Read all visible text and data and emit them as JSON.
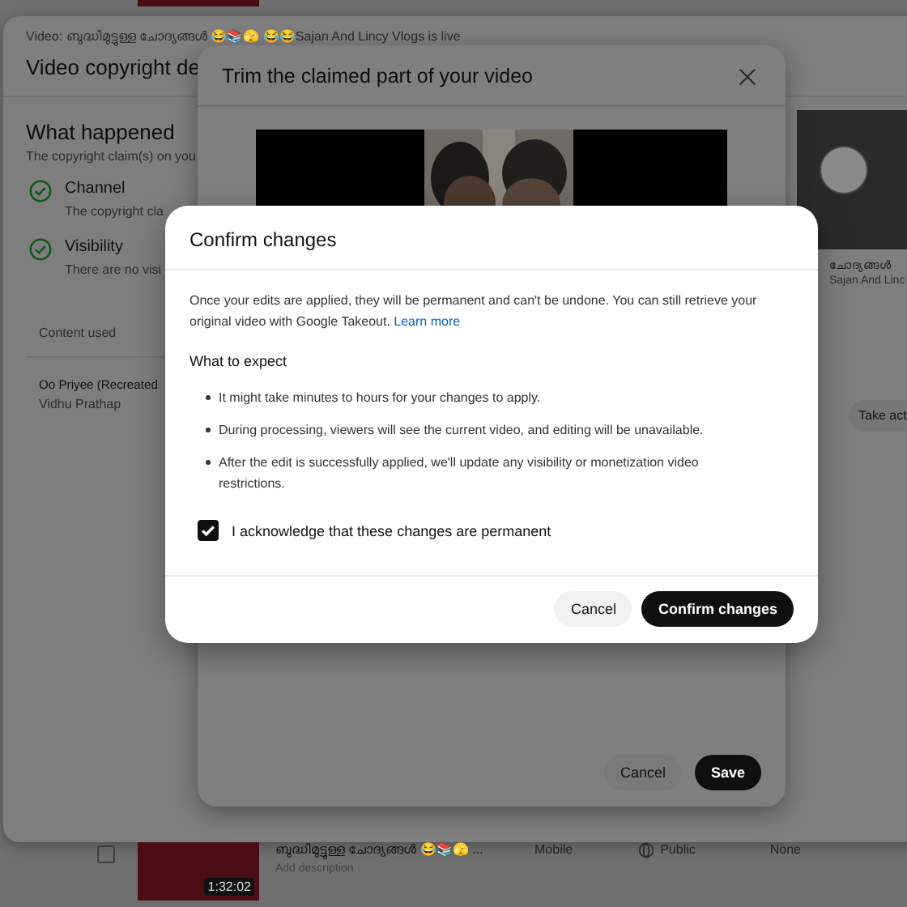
{
  "copyright_panel": {
    "video_line": "Video: ബുദ്ധിമുട്ടുള്ള ചോദ്യങ്ങൾ 😂📚🫣 😂😂Sajan And Lincy Vlogs is live",
    "title": "Video copyright de",
    "section_title": "What happened",
    "section_subtitle": "The copyright claim(s) on you",
    "checks": [
      {
        "label": "Channel",
        "detail": "The copyright cla"
      },
      {
        "label": "Visibility",
        "detail": "There are no visi"
      }
    ],
    "content_header": "Content used",
    "content_title": "Oo Priyee (Recreated",
    "content_artist": "Vidhu Prathap",
    "side_video": {
      "title": "ചോദ്യങ്ങൾ",
      "channel": "Sajan And Linc"
    },
    "action_button": "Take act"
  },
  "trim_dialog": {
    "title": "Trim the claimed part of your video",
    "buttons": [
      {
        "label": "Cancel",
        "kind": "text"
      },
      {
        "label": "Save",
        "kind": "primary"
      }
    ]
  },
  "confirm_dialog": {
    "title": "Confirm changes",
    "intro": "Once your edits are applied, they will be permanent and can't be undone. You can still retrieve your original video with Google Takeout.",
    "link": "Learn more",
    "subheading": "What to expect",
    "bullets": [
      "It might take minutes to hours for your changes to apply.",
      "During processing, viewers will see the current video, and editing will be unavailable.",
      "After the edit is successfully applied, we'll update any visibility or monetization video restrictions."
    ],
    "acknowledge": {
      "label": "I acknowledge that these changes are permanent",
      "checked": true
    },
    "buttons": [
      {
        "label": "Cancel",
        "kind": "text"
      },
      {
        "label": "Confirm changes",
        "kind": "primary"
      }
    ]
  },
  "video_row": {
    "duration": "1:32:02",
    "title": "ബുദ്ധിമുട്ടുള്ള ചോദ്യങ്ങൾ 😂📚🫣 ...",
    "description": "Add description",
    "device": "Mobile",
    "visibility": "Public",
    "restrictions": "None",
    "checked": false
  }
}
